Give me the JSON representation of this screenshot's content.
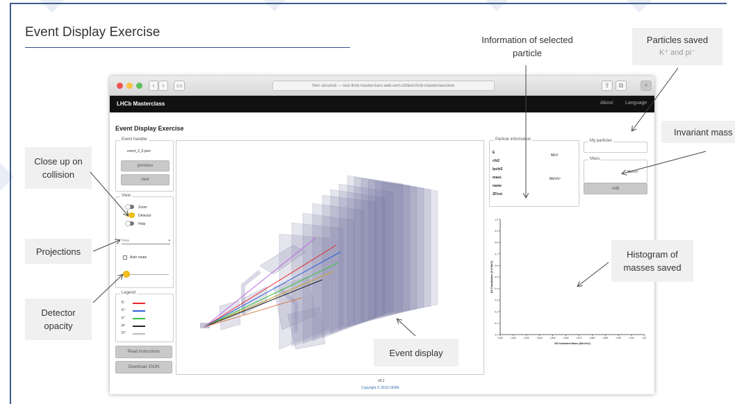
{
  "slide": {
    "title": "Event Display Exercise"
  },
  "browser": {
    "nav_back": "‹",
    "nav_forward": "›",
    "url": "Non sécurisé — test-lhcb-masterclass.web.cern.ch/test-lhcb-masterclass/eve",
    "brand": "LHCb Masterclass",
    "nav_links": [
      "About",
      "Language"
    ]
  },
  "app": {
    "title": "Event Display Exercise",
    "event_handler": {
      "legend": "Event handler",
      "file": "event_3_5.json",
      "previous": "previous",
      "next": "next"
    },
    "view": {
      "legend": "View",
      "toggles": [
        {
          "label": "Zoom",
          "on": false
        },
        {
          "label": "Detector",
          "on": true
        },
        {
          "label": "Help",
          "on": false
        }
      ],
      "select": "View",
      "auto_rotate": "Auto rotate",
      "opacity_level": 0.1
    },
    "legend": {
      "legend": "Legend",
      "items": [
        {
          "label": "K⁻",
          "color": "#e8262b"
        },
        {
          "label": "K⁺",
          "color": "#2e5fd6"
        },
        {
          "label": "p⁺",
          "color": "#35c23c"
        },
        {
          "label": "pi⁻",
          "color": "#222222"
        },
        {
          "label": "D⁰",
          "color": "#bbbbbb"
        }
      ]
    },
    "buttons": {
      "read_instructions": "Read instructions",
      "download_json": "Download JSON"
    },
    "particle_info": {
      "legend": "Particle information",
      "rows": [
        "E",
        "chi2",
        "Ipchi2",
        "mass",
        "name",
        "ZFirst"
      ],
      "unit_mev": "MeV",
      "unit_mevc2": "MeV/c²"
    },
    "my_particles": {
      "legend": "My particles"
    },
    "mass": {
      "legend": "Mass",
      "unit": "MeV/c²",
      "add": "Add"
    },
    "histogram": {
      "ylabel": "D0 Candidates (0.5 MeV)",
      "xlabel": "D0 Invariant Mass (MeV/c2)",
      "y_ticks": [
        "1.0",
        "0.9",
        "0.8",
        "0.7",
        "0.6",
        "0.5",
        "0.4",
        "0.3",
        "0.2",
        "0.1",
        "0.0"
      ],
      "x_ticks": [
        "1,810",
        "1,820",
        "1,830",
        "1,840",
        "1,850",
        "1,860",
        "1,870",
        "1,880",
        "1,890",
        "1,900",
        "1,910",
        "1,920"
      ]
    },
    "footer": {
      "version": "v0.1",
      "copyright": "Copyright © 2018 CERN"
    }
  },
  "annotations": {
    "info_selected": "Information of selected particle",
    "particles_saved": "Particles saved",
    "particles_saved_sub": "K⁺ and pi⁻",
    "invariant_mass": "Invariant mass",
    "close_up": "Close up on collision",
    "projections": "Projections",
    "detector_opacity": "Detector opacity",
    "histogram": "Histogram of masses saved",
    "event_display": "Event display"
  },
  "colors": {
    "accent": "#2c4f86",
    "navbar": "#111111",
    "toggle_on": "#f4c21e",
    "callout_bg": "#f0f0f0"
  }
}
